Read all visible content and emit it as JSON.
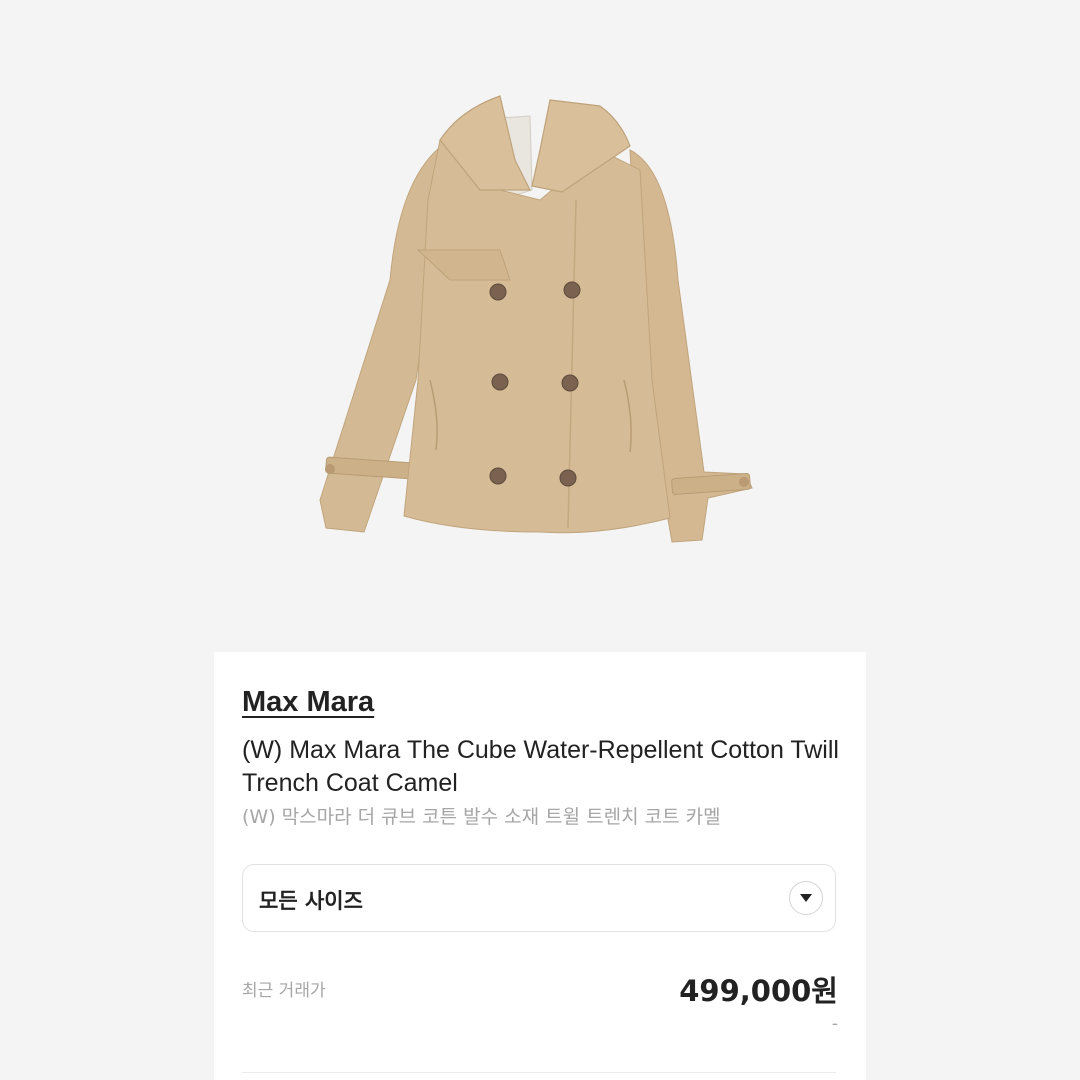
{
  "product": {
    "brand": "Max Mara",
    "name_en": "(W) Max Mara The Cube Water-Repellent Cotton Twill Trench Coat Camel",
    "name_ko": "(W) 막스마라 더 큐브 코튼 발수 소재 트윌 트렌치 코트 카멜",
    "image_icon": "trench-coat-image"
  },
  "size_selector": {
    "value": "모든 사이즈",
    "icon": "chevron-down-icon"
  },
  "price": {
    "label": "최근 거래가",
    "value": "499,000원",
    "change": "-"
  },
  "colors": {
    "coat": "#d6bc96",
    "background": "#f4f4f4",
    "text": "#222222",
    "muted": "#a6a6a6"
  }
}
